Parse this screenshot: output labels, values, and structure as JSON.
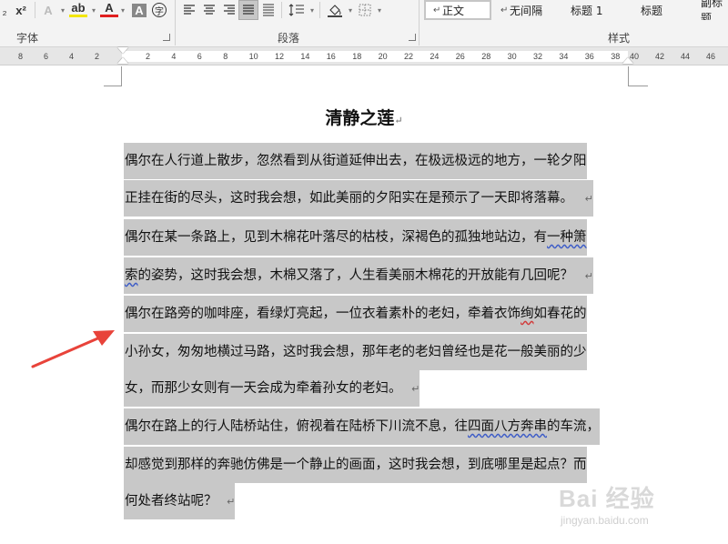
{
  "ribbon": {
    "buttons": [
      "x²",
      "A",
      "A",
      "A",
      "字"
    ],
    "group_labels": {
      "font": "字体",
      "paragraph": "段落",
      "styles": "样式"
    },
    "styles": [
      {
        "mark": "↵",
        "label": "正文"
      },
      {
        "mark": "↵",
        "label": "无间隔"
      },
      {
        "label": "标题 1"
      },
      {
        "label": "标题"
      },
      {
        "label": "副标题"
      }
    ]
  },
  "ruler": {
    "left_ticks": [
      "8",
      "6",
      "4",
      "2"
    ],
    "ticks": [
      "2",
      "4",
      "6",
      "8",
      "10",
      "12",
      "14",
      "16",
      "18",
      "20",
      "22",
      "24",
      "26",
      "28",
      "30",
      "32",
      "34",
      "36",
      "38"
    ],
    "right_ticks": [
      "40",
      "42",
      "44",
      "46"
    ]
  },
  "document": {
    "title": "清静之莲",
    "para_mark": "↵",
    "lines": [
      {
        "text": "偶尔在人行道上散步，忽然看到从街道延伸出去，在极远极远的地方，一轮夕阳"
      },
      {
        "text": "正挂在街的尽头，这时我会想，如此美丽的夕阳实在是预示了一天即将落幕。",
        "end_mark": true
      },
      {
        "text": "偶尔在某一条路上，见到木棉花叶落尽的枯枝，深褐色的孤独地站边，有",
        "tail": "一种箫"
      },
      {
        "text": "",
        "head": "索",
        "text_after": "的姿势，这时我会想，木棉又落了，人生看美丽木棉花的开放能有几回呢？",
        "end_mark": true
      },
      {
        "text": "偶尔在路旁的咖啡座，看绿灯亮起，一位衣着素朴的老妇，牵着衣饰",
        "red": "绚",
        "tail": "如春花的"
      },
      {
        "text": "小孙女，匆匆地横过马路，这时我会想，那年老的老妇曾经也是花一般美丽的少"
      },
      {
        "text": "女，而那少女则有一天会成为牵着孙女的老妇。",
        "end_mark": true
      },
      {
        "text": "偶尔在路上的行人陆桥站住，俯视着在陆桥下川流不息，往",
        "tail": "四面八方奔串",
        "after": "的车流，"
      },
      {
        "text": "却感觉到那样的奔驰仿佛是一个静止的画面，这时我会想，到底哪里是起点？而"
      },
      {
        "text": "何处者终站呢？",
        "end_mark": true
      }
    ]
  },
  "watermark": {
    "main": "Bai 经验",
    "url": "jingyan.baidu.com"
  },
  "colors": {
    "selection": "#c8c8c8",
    "arrow": "#e8433a",
    "ribbon_bg": "#f3f3f3"
  }
}
